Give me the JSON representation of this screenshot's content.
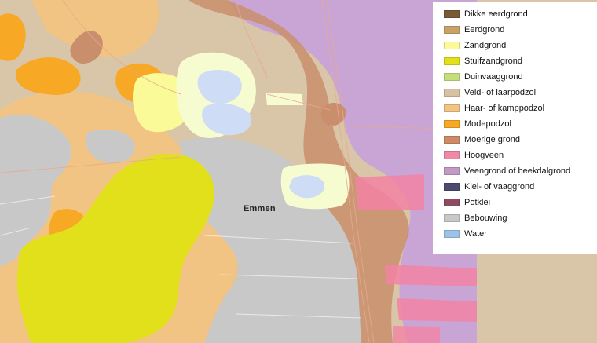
{
  "map": {
    "place_label": "Emmen",
    "colors": {
      "background": "#d9c5a8",
      "dikke_eerdgrond": "#7a5a36",
      "eerdgrond": "#c9a169",
      "zandgrond": "#fafa98",
      "stuifzandgrond": "#e1e01b",
      "duinvaaggrond": "#d6e78d",
      "veld_laarpodzol": "#d9c5a8",
      "haar_kamppodzol": "#f2c483",
      "modepodzol": "#f7a824",
      "moerige_grond": "#c98e6b",
      "hoogveen": "#f283a4",
      "veengrond_beekdalgrond": "#c9a5d6",
      "klei_vaaggrond": "#4f4a72",
      "potklei": "#95516b",
      "bebouwing": "#c8c8c8",
      "water": "#cfdcf5"
    }
  },
  "legend": {
    "items": [
      {
        "label": "Dikke eerdgrond",
        "color": "#7a5a36"
      },
      {
        "label": "Eerdgrond",
        "color": "#c9a169"
      },
      {
        "label": "Zandgrond",
        "color": "#fafa98"
      },
      {
        "label": "Stuifzandgrond",
        "color": "#e1e01b"
      },
      {
        "label": "Duinvaaggrond",
        "color": "#c5de7c"
      },
      {
        "label": "Veld- of laarpodzol",
        "color": "#d6c1a2"
      },
      {
        "label": "Haar- of kamppodzol",
        "color": "#f2c483"
      },
      {
        "label": "Modepodzol",
        "color": "#f7a824"
      },
      {
        "label": "Moerige grond",
        "color": "#cd8a66"
      },
      {
        "label": "Hoogveen",
        "color": "#ef8aa6"
      },
      {
        "label": "Veengrond of beekdalgrond",
        "color": "#c29bc4"
      },
      {
        "label": "Klei- of vaaggrond",
        "color": "#4c4a6e"
      },
      {
        "label": "Potklei",
        "color": "#8e4a60"
      },
      {
        "label": "Bebouwing",
        "color": "#c8c8c8"
      },
      {
        "label": "Water",
        "color": "#9cc3e6"
      }
    ]
  }
}
